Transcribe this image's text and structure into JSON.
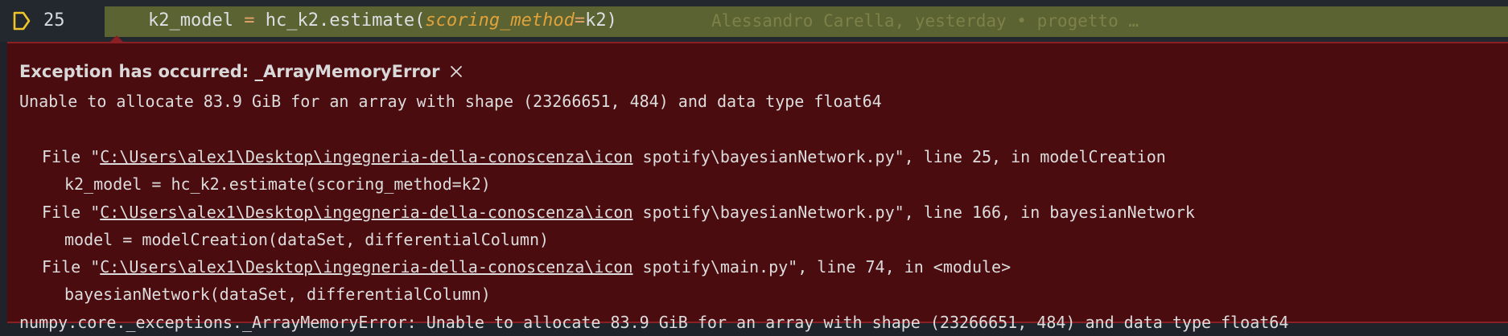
{
  "editor": {
    "line_number": "25",
    "code": {
      "var": "k2_model",
      "op": " = ",
      "call": "hc_k2.estimate(",
      "param": "scoring_method",
      "eq": "=",
      "arg": "k2",
      "close": ")"
    },
    "blame": "Alessandro Carella, yesterday • progetto …",
    "colors": {
      "highlight": "#5c6332",
      "operator": "#e5a36a",
      "parameter": "#e0a23a"
    }
  },
  "exception": {
    "title": "Exception has occurred: _ArrayMemoryError",
    "message": "Unable to allocate 83.9 GiB for an array with shape (23266651, 484) and data type float64",
    "traceback": [
      {
        "prefix": "File \"",
        "link": "C:\\Users\\alex1\\Desktop\\ingegneria-della-conoscenza\\icon",
        "suffix": " spotify\\bayesianNetwork.py\", line 25, in modelCreation",
        "code": "k2_model = hc_k2.estimate(scoring_method=k2)"
      },
      {
        "prefix": "File \"",
        "link": "C:\\Users\\alex1\\Desktop\\ingegneria-della-conoscenza\\icon",
        "suffix": " spotify\\bayesianNetwork.py\", line 166, in bayesianNetwork",
        "code": "model = modelCreation(dataSet, differentialColumn)"
      },
      {
        "prefix": "File \"",
        "link": "C:\\Users\\alex1\\Desktop\\ingegneria-della-conoscenza\\icon",
        "suffix": " spotify\\main.py\", line 74, in <module>",
        "code": "bayesianNetwork(dataSet, differentialColumn)"
      }
    ],
    "final": "numpy.core._exceptions._ArrayMemoryError: Unable to allocate 83.9 GiB for an array with shape (23266651, 484) and data type float64",
    "colors": {
      "background": "#4b0c10",
      "border": "#8a1f24"
    }
  },
  "icons": {
    "breakpoint": "debug-stackframe-icon",
    "close": "close-icon"
  }
}
